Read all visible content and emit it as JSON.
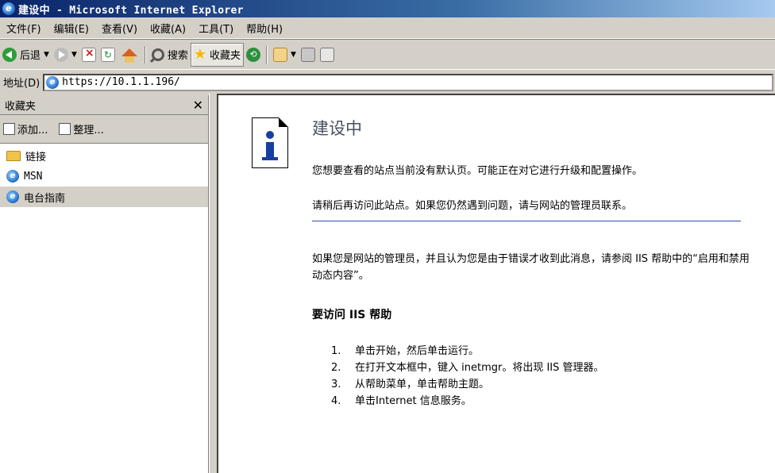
{
  "window": {
    "title": "建设中 - Microsoft Internet Explorer"
  },
  "menu": [
    "文件(F)",
    "编辑(E)",
    "查看(V)",
    "收藏(A)",
    "工具(T)",
    "帮助(H)"
  ],
  "toolbar": {
    "back_label": "后退",
    "search_label": "搜索",
    "favorites_label": "收藏夹"
  },
  "address": {
    "label": "地址(D)",
    "url": "https://10.1.1.196/"
  },
  "favorites": {
    "title": "收藏夹",
    "add_label": "添加...",
    "organize_label": "整理...",
    "items": [
      {
        "label": "链接",
        "type": "folder"
      },
      {
        "label": "MSN",
        "type": "link"
      },
      {
        "label": "电台指南",
        "type": "link"
      }
    ]
  },
  "content": {
    "title": "建设中",
    "p1": "您想要查看的站点当前没有默认页。可能正在对它进行升级和配置操作。",
    "p2": "请稍后再访问此站点。如果您仍然遇到问题，请与网站的管理员联系。",
    "p3": "如果您是网站的管理员，并且认为您是由于错误才收到此消息，请参阅 IIS 帮助中的“启用和禁用动态内容”。",
    "help_heading": "要访问 IIS 帮助",
    "steps": [
      {
        "num": "1.",
        "text": "单击开始，然后单击运行。"
      },
      {
        "num": "2.",
        "text": "在打开文本框中，键入 inetmgr。将出现 IIS 管理器。"
      },
      {
        "num": "3.",
        "text": "从帮助菜单，单击帮助主题。"
      },
      {
        "num": "4.",
        "text": "单击Internet 信息服务。"
      }
    ]
  }
}
